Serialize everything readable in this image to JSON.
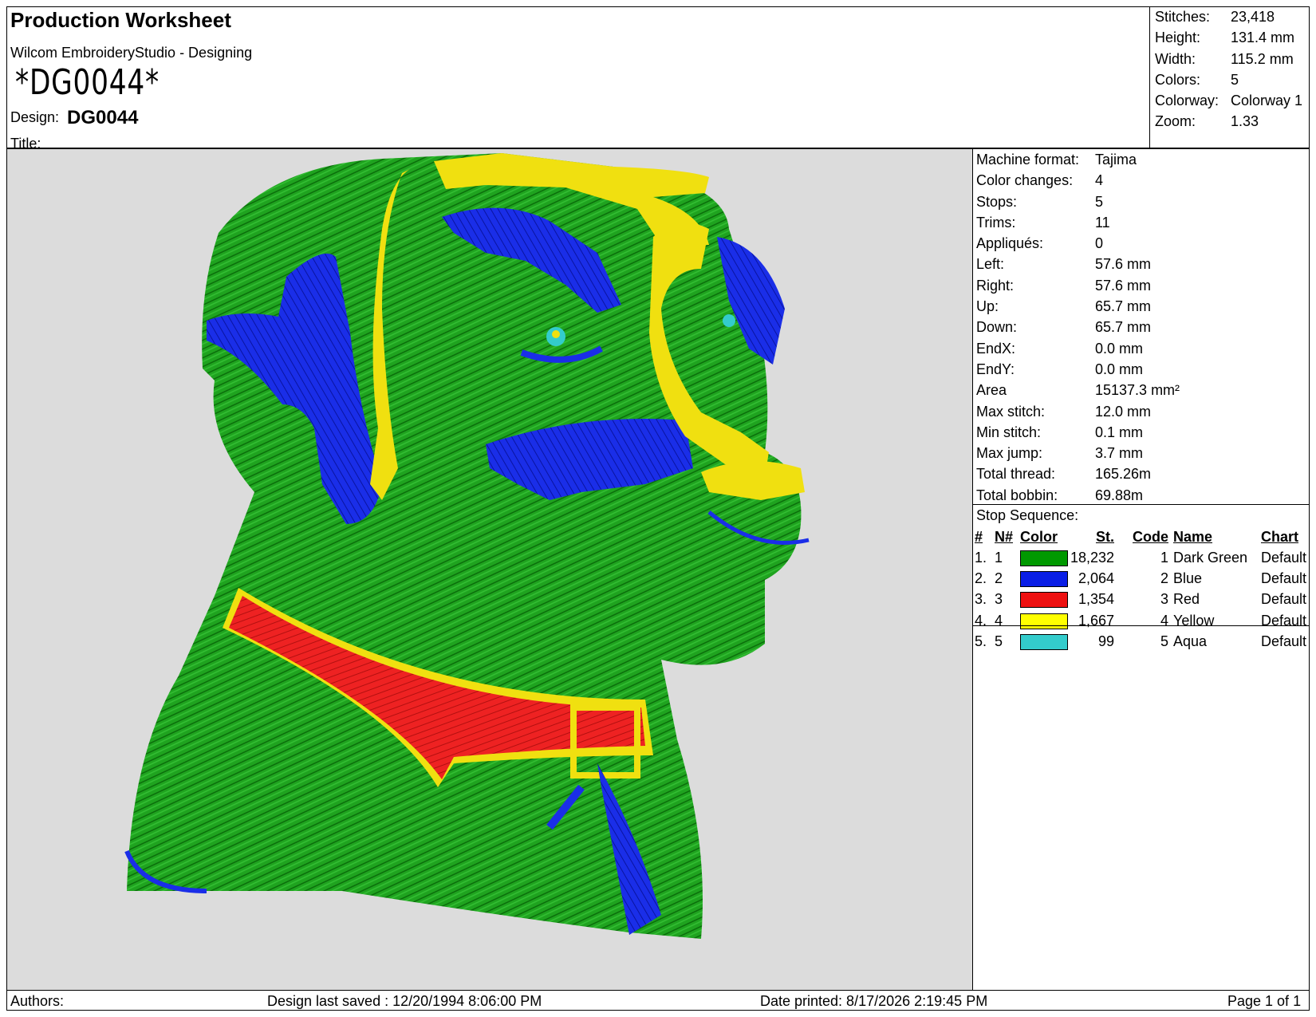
{
  "header": {
    "title": "Production Worksheet",
    "subtitle": "Wilcom EmbroideryStudio - Designing",
    "barcode": "*DG0044*",
    "design_label": "Design:",
    "design_value": "DG0044",
    "title_label": "Title:"
  },
  "stats": [
    {
      "k": "Stitches:",
      "v": "23,418"
    },
    {
      "k": "Height:",
      "v": "131.4 mm"
    },
    {
      "k": "Width:",
      "v": "115.2 mm"
    },
    {
      "k": "Colors:",
      "v": "5"
    },
    {
      "k": "Colorway:",
      "v": "Colorway 1"
    },
    {
      "k": "Zoom:",
      "v": "1.33"
    }
  ],
  "info": [
    {
      "k": "Machine format:",
      "v": "Tajima"
    },
    {
      "k": "Color changes:",
      "v": "4"
    },
    {
      "k": "Stops:",
      "v": "5"
    },
    {
      "k": "Trims:",
      "v": "11"
    },
    {
      "k": "Appliqués:",
      "v": "0"
    },
    {
      "k": "Left:",
      "v": "57.6 mm"
    },
    {
      "k": "Right:",
      "v": "57.6 mm"
    },
    {
      "k": "Up:",
      "v": "65.7 mm"
    },
    {
      "k": "Down:",
      "v": "65.7 mm"
    },
    {
      "k": "EndX:",
      "v": "0.0 mm"
    },
    {
      "k": "EndY:",
      "v": "0.0 mm"
    },
    {
      "k": "Area",
      "v": "15137.3 mm²"
    },
    {
      "k": "Max stitch:",
      "v": "12.0 mm"
    },
    {
      "k": "Min stitch:",
      "v": "0.1 mm"
    },
    {
      "k": "Max jump:",
      "v": "3.7 mm"
    },
    {
      "k": "Total thread:",
      "v": "165.26m"
    },
    {
      "k": "Total bobbin:",
      "v": "69.88m"
    }
  ],
  "stop_sequence": {
    "title": "Stop Sequence:",
    "headers": {
      "num": "#",
      "n": "N#",
      "color": "Color",
      "st": "St.",
      "code": "Code",
      "name": "Name",
      "chart": "Chart"
    },
    "rows": [
      {
        "num": "1.",
        "n": "1",
        "color": "#009900",
        "st": "18,232",
        "code": "1",
        "name": "Dark Green",
        "chart": "Default"
      },
      {
        "num": "2.",
        "n": "2",
        "color": "#0a1ee6",
        "st": "2,064",
        "code": "2",
        "name": "Blue",
        "chart": "Default"
      },
      {
        "num": "3.",
        "n": "3",
        "color": "#ee1111",
        "st": "1,354",
        "code": "3",
        "name": "Red",
        "chart": "Default"
      },
      {
        "num": "4.",
        "n": "4",
        "color": "#ffff00",
        "st": "1,667",
        "code": "4",
        "name": "Yellow",
        "chart": "Default"
      },
      {
        "num": "5.",
        "n": "5",
        "color": "#33cccc",
        "st": "99",
        "code": "5",
        "name": "Aqua",
        "chart": "Default"
      }
    ]
  },
  "footer": {
    "authors": "Authors:",
    "saved": "Design last saved : 12/20/1994 8:06:00 PM",
    "printed": "Date printed: 8/17/2026 2:19:45 PM",
    "page": "Page 1 of 1"
  }
}
